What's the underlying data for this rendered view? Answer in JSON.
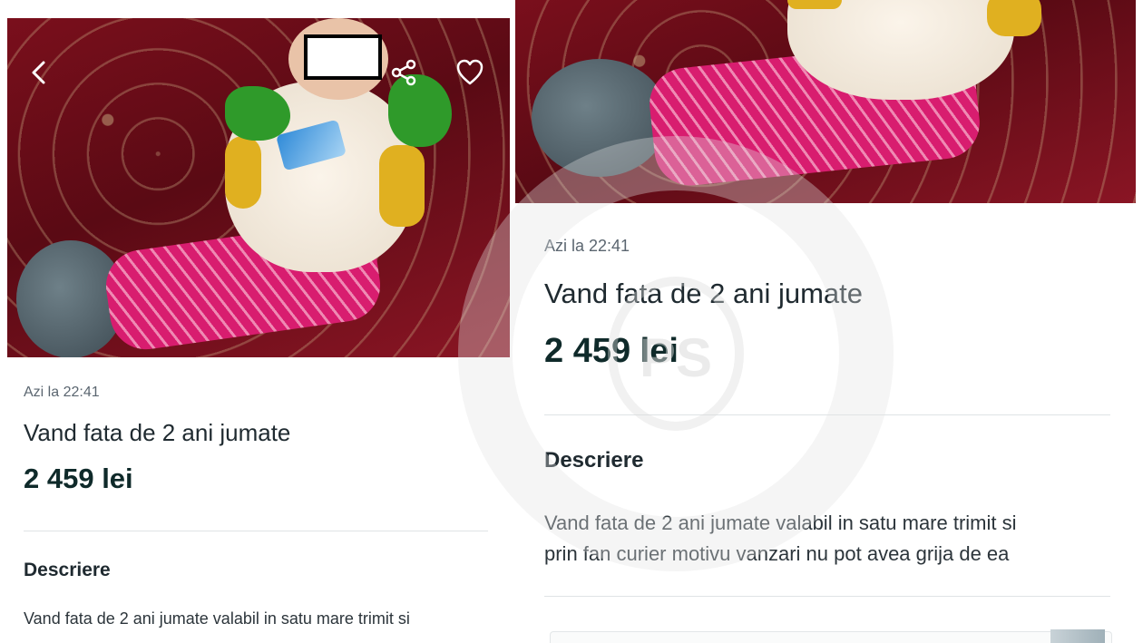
{
  "listing": {
    "timestamp": "Azi la 22:41",
    "title": "Vand fata de 2 ani jumate",
    "price": "2 459 lei",
    "description_heading": "Descriere",
    "description_line1": "Vand fata de 2 ani jumate valabil in satu mare trimit si",
    "description_line2": "prin fan curier motivu vanzari nu pot avea grija de ea"
  },
  "watermark": {
    "text": "PS"
  },
  "icons": {
    "back": "chevron-left-icon",
    "share": "share-icon",
    "favorite": "heart-icon"
  },
  "colors": {
    "price": "#0f2a2a",
    "title": "#1f2a30",
    "timestamp": "#5b6670",
    "divider": "#dfe3e5"
  }
}
